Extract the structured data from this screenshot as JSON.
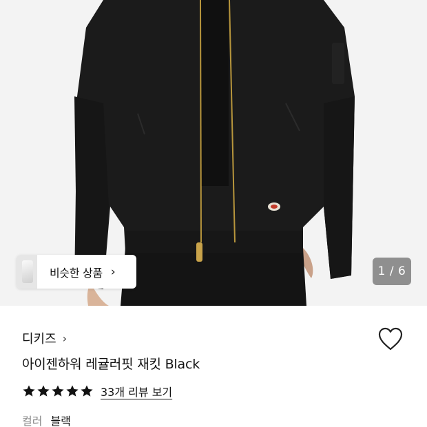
{
  "gallery": {
    "similar_label": "비슷한 상품",
    "similar_arrow": "›",
    "counter": "1 / 6"
  },
  "product": {
    "brand": "디키즈",
    "brand_chevron": "›",
    "title": "아이젠하워 레귤러핏 재킷 Black",
    "rating_stars": 5,
    "review_link": "33개 리뷰 보기",
    "color_label": "컬러",
    "color_value": "블랙"
  },
  "colors": {
    "garment": "#1a1a1a",
    "zipper": "#b8963c",
    "star": "#111111"
  }
}
